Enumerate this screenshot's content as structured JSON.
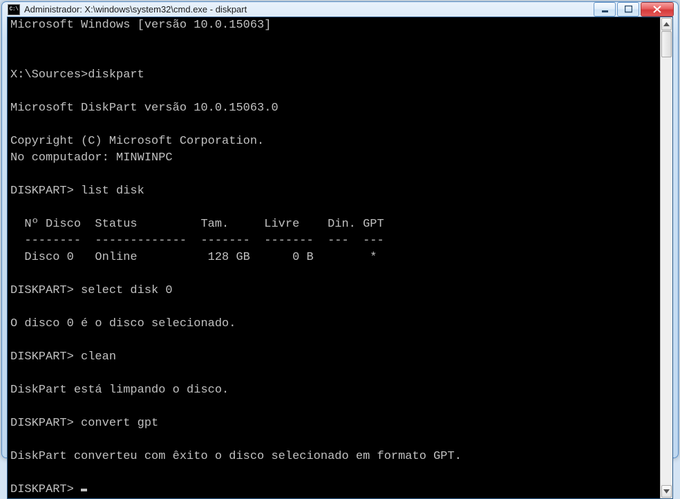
{
  "window": {
    "icon_text": "C:\\",
    "title": "Administrador: X:\\windows\\system32\\cmd.exe - diskpart"
  },
  "terminal": {
    "lines": [
      "Microsoft Windows [versão 10.0.15063]",
      "",
      "",
      "X:\\Sources>diskpart",
      "",
      "Microsoft DiskPart versão 10.0.15063.0",
      "",
      "Copyright (C) Microsoft Corporation.",
      "No computador: MINWINPC",
      "",
      "DISKPART> list disk",
      "",
      "  Nº Disco  Status         Tam.     Livre    Din. GPT",
      "  --------  -------------  -------  -------  ---  ---",
      "  Disco 0   Online          128 GB      0 B        *",
      "",
      "DISKPART> select disk 0",
      "",
      "O disco 0 é o disco selecionado.",
      "",
      "DISKPART> clean",
      "",
      "DiskPart está limpando o disco.",
      "",
      "DISKPART> convert gpt",
      "",
      "DiskPart converteu com êxito o disco selecionado em formato GPT.",
      "",
      "DISKPART> "
    ]
  }
}
